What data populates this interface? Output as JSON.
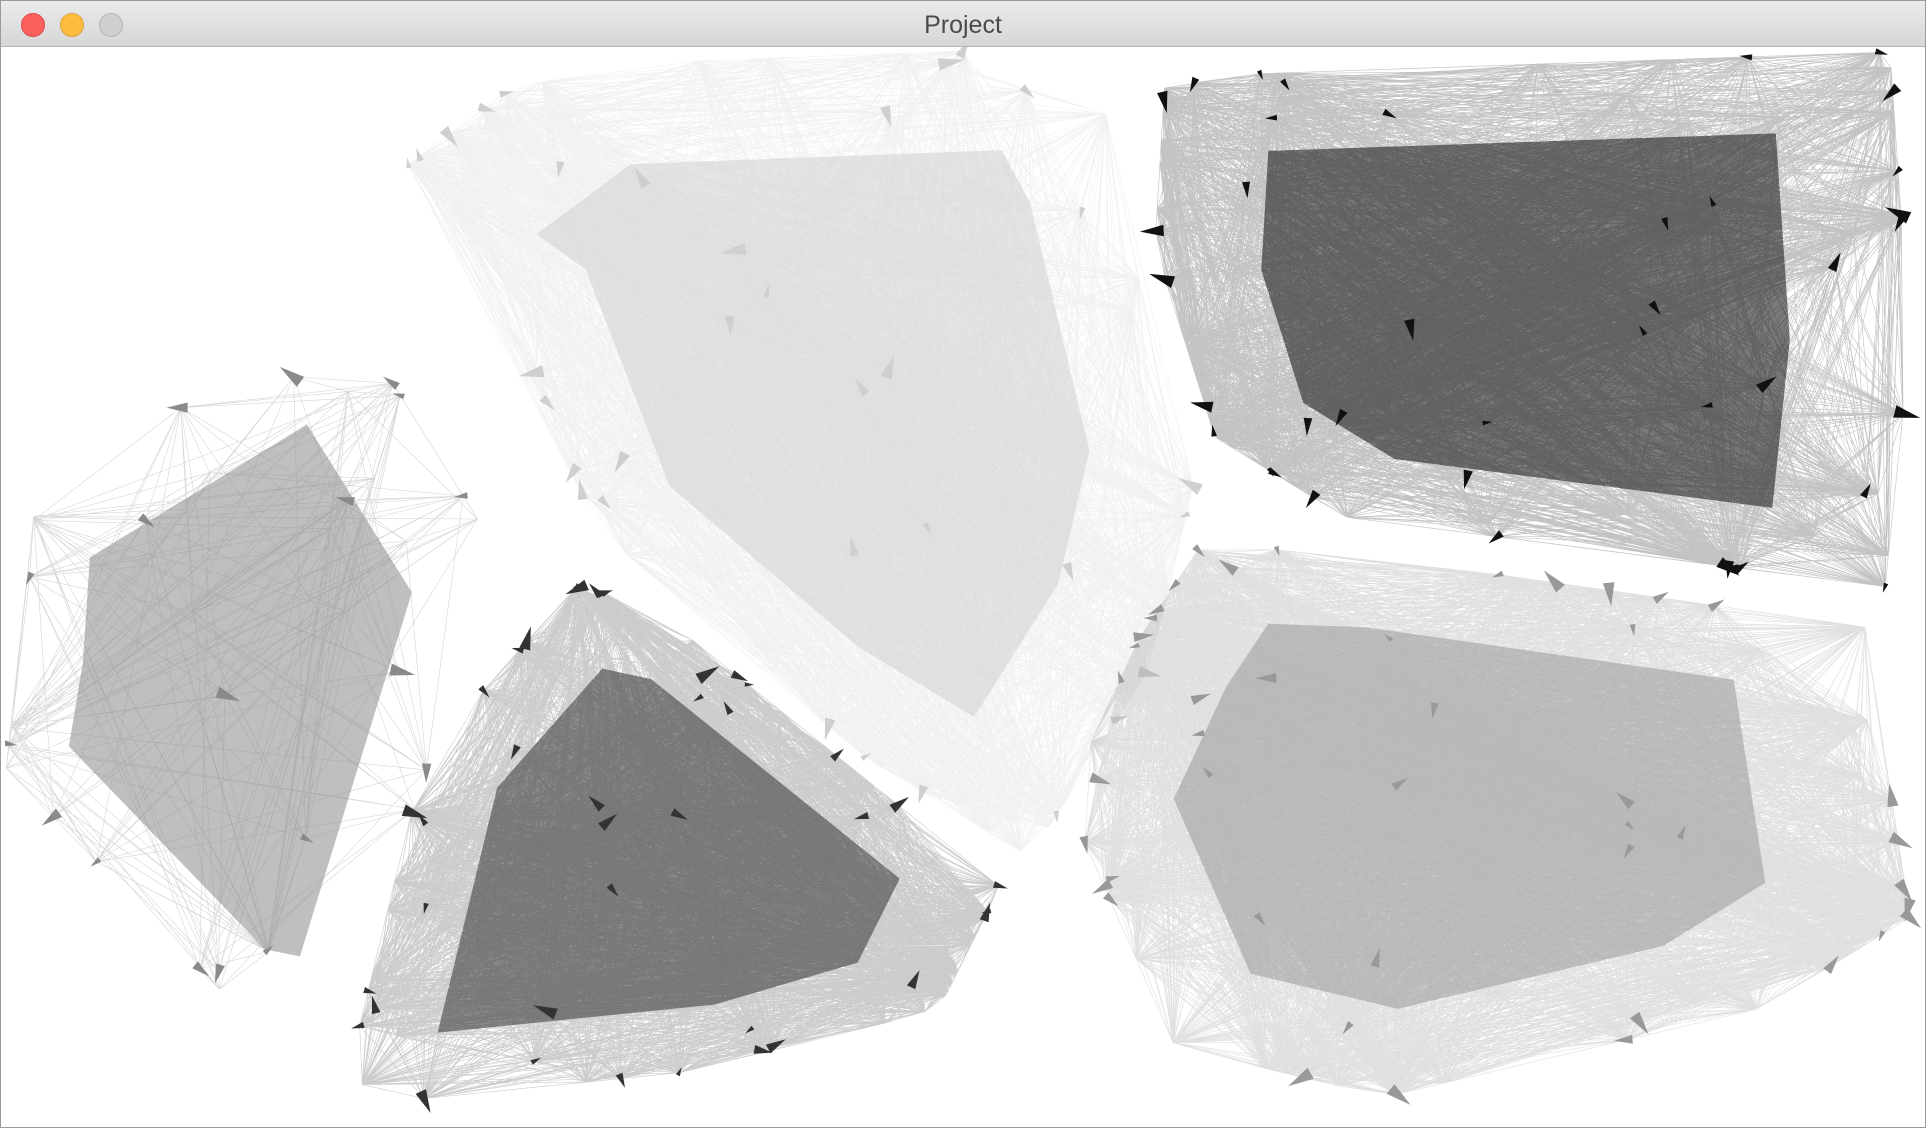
{
  "window": {
    "title": "Project",
    "buttons": {
      "close": "close-button",
      "minimize": "minimize-button",
      "zoom": "zoom-button"
    }
  },
  "graph": {
    "clusters": [
      {
        "id": "cluster-left",
        "color": "#8a8a8a",
        "node_count": 36,
        "edge_density": 0.35,
        "edge_opacity": 0.35
      },
      {
        "id": "cluster-top-center",
        "color": "#cfcfcf",
        "node_count": 70,
        "edge_density": 0.9,
        "edge_opacity": 0.3
      },
      {
        "id": "cluster-top-right",
        "color": "#111111",
        "node_count": 80,
        "edge_density": 0.8,
        "edge_opacity": 0.25
      },
      {
        "id": "cluster-bottom-center",
        "color": "#333333",
        "node_count": 80,
        "edge_density": 0.85,
        "edge_opacity": 0.25
      },
      {
        "id": "cluster-bottom-right",
        "color": "#999999",
        "node_count": 90,
        "edge_density": 0.95,
        "edge_opacity": 0.3
      }
    ]
  }
}
